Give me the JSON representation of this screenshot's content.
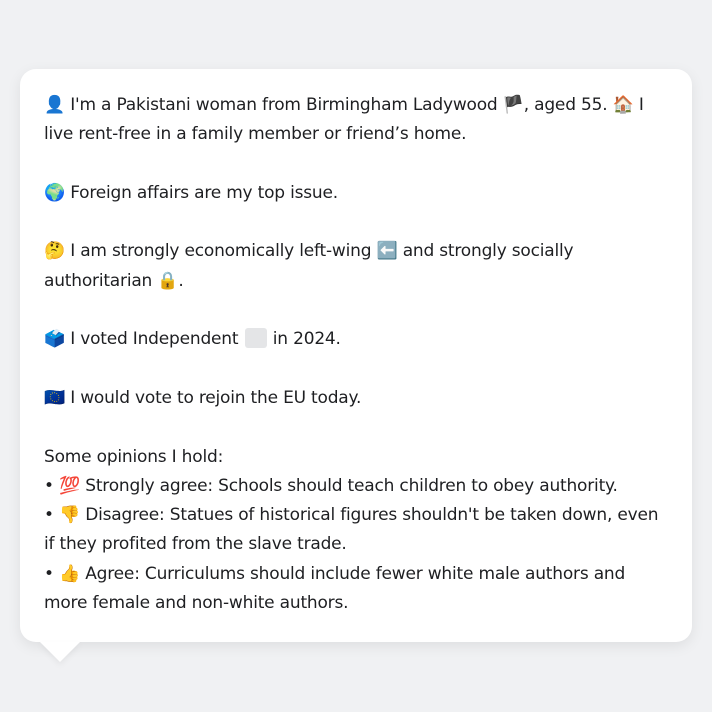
{
  "persona": {
    "intro_icon": "👤",
    "intro_text_1": "I'm a Pakistani woman from Birmingham Ladywood",
    "england_flag_icon": "🏴",
    "intro_text_2": ", aged 55.",
    "home_icon": "🏠",
    "intro_text_3": "I live rent-free in a family member or friend’s home.",
    "issue_icon": "🌍",
    "issue_text": "Foreign affairs are my top issue.",
    "ideology_icon": "🤔",
    "ideology_text_1": "I am strongly economically left-wing",
    "left_arrow_icon": "⬅️",
    "ideology_text_2": "and strongly socially authoritarian",
    "lock_icon": "🔒",
    "ideology_text_3": ".",
    "vote_icon": "🗳️",
    "vote_text_1": "I voted Independent",
    "vote_text_2": "in 2024.",
    "eu_icon": "🇪🇺",
    "eu_text": "I would vote to rejoin the EU today."
  },
  "opinions": {
    "heading": "Some opinions I hold:",
    "bullet": "•",
    "items": [
      {
        "icon": "💯",
        "text": "Strongly agree: Schools should teach children to obey authority."
      },
      {
        "icon": "👎",
        "text": "Disagree: Statues of historical figures shouldn't be taken down, even if they profited from the slave trade."
      },
      {
        "icon": "👍",
        "text": "Agree: Curriculums should include fewer white male authors and more female and non-white authors."
      }
    ]
  },
  "colors": {
    "background": "#f0f1f3",
    "bubble": "#ffffff",
    "text": "#1e1f22"
  }
}
